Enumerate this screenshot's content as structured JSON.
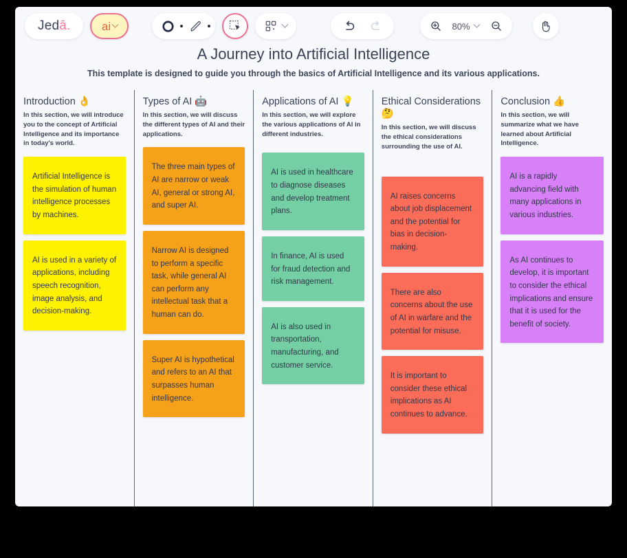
{
  "toolbar": {
    "logo_main": "Jed",
    "logo_accent": "ā.",
    "ai_label": "ai",
    "shape_icon": "circle-shape-icon",
    "pen_icon": "pencil-icon",
    "select_icon": "select-cursor-icon",
    "template_icon": "templates-grid-icon",
    "undo_icon": "undo-icon",
    "redo_icon": "redo-icon",
    "zoom_in_icon": "zoom-in-icon",
    "zoom_out_icon": "zoom-out-icon",
    "zoom_level": "80%",
    "hand_icon": "hand-pan-icon"
  },
  "document": {
    "title": "A Journey into Artificial Intelligence",
    "subtitle": "This template is designed to guide you through the basics of Artificial Intelligence and its various applications."
  },
  "columns": [
    {
      "title": "Introduction 👌",
      "description": "In this section, we will introduce you to the concept of Artificial Intelligence and its importance in today's world.",
      "color": "yellow",
      "cards": [
        "Artificial Intelligence is the simulation of human intelligence processes by machines.",
        "AI is used in a variety of applications, including speech recognition, image analysis, and decision-making."
      ]
    },
    {
      "title": "Types of AI 🤖",
      "description": "In this section, we will discuss the different types of AI and their applications.",
      "color": "orange",
      "cards": [
        "The three main types of AI are narrow or weak AI, general or strong AI, and super AI.",
        "Narrow AI is designed to perform a specific task, while general AI can perform any intellectual task that a human can do.",
        "Super AI is hypothetical and refers to an AI that surpasses human intelligence."
      ]
    },
    {
      "title": "Applications of AI 💡",
      "description": "In this section, we will explore the various applications of AI in different industries.",
      "color": "green",
      "cards": [
        "AI is used in healthcare to diagnose diseases and develop treatment plans.",
        "In finance, AI is used for fraud detection and risk management.",
        "AI is also used in transportation, manufacturing, and customer service."
      ]
    },
    {
      "title": "Ethical Considerations 🤔",
      "description": "In this section, we will discuss the ethical considerations surrounding the use of AI.",
      "color": "red",
      "cards": [
        "AI raises concerns about job displacement and the potential for bias in decision-making.",
        "There are also concerns about the use of AI in warfare and the potential for misuse.",
        "It is important to consider these ethical implications as AI continues to advance."
      ]
    },
    {
      "title": "Conclusion 👍",
      "description": "In this section, we will summarize what we have learned about Artificial Intelligence.",
      "color": "purple",
      "cards": [
        "AI is a rapidly advancing field with many applications in various industries.",
        "As AI continues to develop, it is important to consider the ethical implications and ensure that it is used for the benefit of society."
      ]
    }
  ],
  "colors": {
    "yellow": "#fff200",
    "orange": "#f6a11a",
    "green": "#74cfa4",
    "red": "#fc6d59",
    "purple": "#d780f7",
    "accent_pink": "#ef6f8e",
    "canvas": "#f6f8fc"
  }
}
